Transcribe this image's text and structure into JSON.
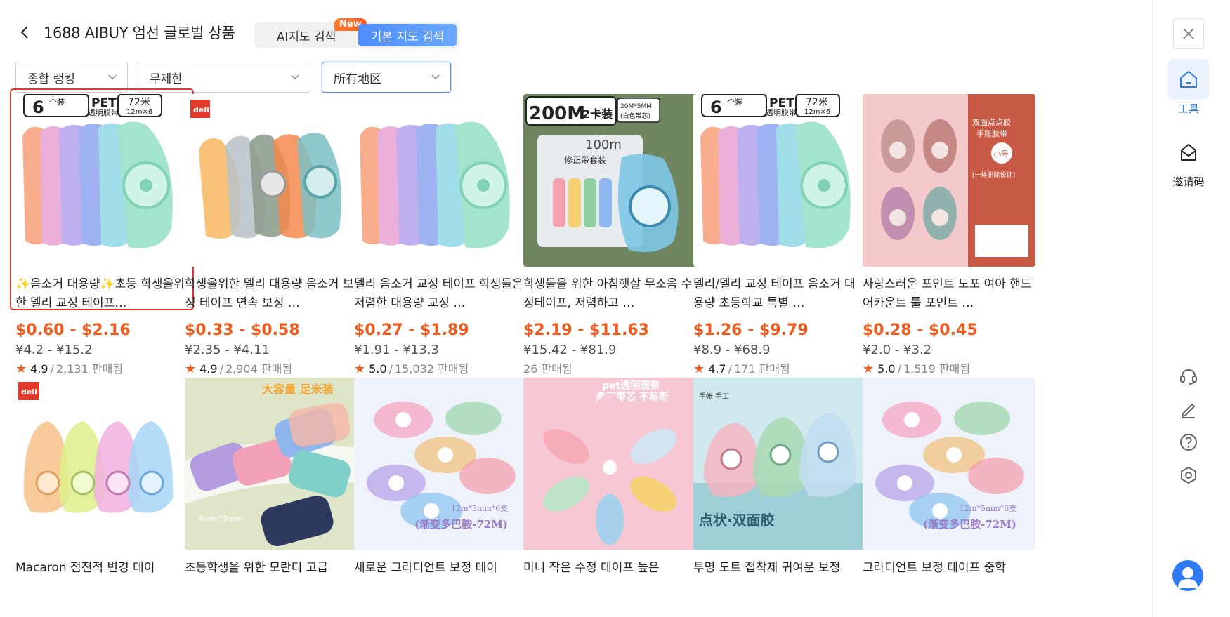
{
  "header": {
    "title": "1688 AIBUY 엄선 글로벌 상품",
    "ai_mode_label": "AI지도 검색",
    "new_badge": "New",
    "basic_mode_label": "기본 지도 검색"
  },
  "filters": [
    {
      "value": "종합 랭킹"
    },
    {
      "value": "무제한"
    },
    {
      "value": "所有地区"
    }
  ],
  "products": [
    {
      "title": "✨음소거 대용량✨초등 학생을위한 델리 교정 테이프…",
      "price_usd": "$0.60 - $2.16",
      "price_cny": "¥4.2 - ¥15.2",
      "rating": "4.9",
      "sold": "2,131 판매됨"
    },
    {
      "title": "학생을위한 델리 대용량 음소거 보정 테이프 연속 보정 …",
      "price_usd": "$0.33 - $0.58",
      "price_cny": "¥2.35 - ¥4.11",
      "rating": "4.9",
      "sold": "2,904 판매됨"
    },
    {
      "title": "델리 음소거 교정 테이프 학생들은 저렴한 대용량 교정 …",
      "price_usd": "$0.27 - $1.89",
      "price_cny": "¥1.91 - ¥13.3",
      "rating": "5.0",
      "sold": "15,032 판매됨"
    },
    {
      "title": "학생들을 위한 아침햇살 무소음 수정테이프, 저렴하고 …",
      "price_usd": "$2.19 - $11.63",
      "price_cny": "¥15.42 - ¥81.9",
      "rating": "",
      "sold": "26 판매됨"
    },
    {
      "title": "델리/델리 교정 테이프 음소거 대용량 초등학교 특별 …",
      "price_usd": "$1.26 - $9.79",
      "price_cny": "¥8.9 - ¥68.9",
      "rating": "4.7",
      "sold": "171 판매됨"
    },
    {
      "title": "사랑스러운 포인트 도포 여아 핸드 어카운트 툴 포인트 …",
      "price_usd": "$0.28 - $0.45",
      "price_cny": "¥2.0 - ¥3.2",
      "rating": "5.0",
      "sold": "1,519 판매됨"
    },
    {
      "title": "Macaron 점진적 변경 테이"
    },
    {
      "title": "초등학생을 위한 모란디 고급"
    },
    {
      "title": "새로운 그라디언트 보정 테이"
    },
    {
      "title": "미니 작은 수정 테이프 높은"
    },
    {
      "title": "투명 도트 접착제 귀여운 보정"
    },
    {
      "title": "그라디언트 보정 테이프 중학"
    }
  ],
  "image_text": {
    "p1": {
      "count": "6",
      "unit": "个装",
      "pet": "PET",
      "pet_sub": "透明膜带",
      "len": "72米",
      "len_sub": "12m×6"
    },
    "p2": {
      "brand": "deli"
    },
    "p4": {
      "a": "200M",
      "b": "2卡装",
      "c": "20M*5MM",
      "d": "(白色带芯)",
      "e": "修正带套装",
      "f": "100m"
    },
    "p6": {
      "a": "双面点点胶",
      "b": "手账胶带",
      "c": "小号",
      "d": "[一体删除设计]"
    },
    "p7": {
      "brand": "deli"
    },
    "p8": {
      "a": "大容量 足米装",
      "b": "6mm*5mm"
    },
    "p9": {
      "a": "12m*5mm*6支",
      "b": "(渐变多巴胺-72M)"
    },
    "p10": {
      "a": "pet透明膜带",
      "b": "柔和带芯 不易断"
    },
    "p11": {
      "a": "手帐 手工",
      "b": "点状·双面胶"
    }
  },
  "sidebar": {
    "tools_label": "工具",
    "invite_label": "邀请码"
  },
  "colors": {
    "accent_blue": "#2f7bf5",
    "price_orange": "#f05a1c",
    "selected_border": "#e03a2f"
  }
}
